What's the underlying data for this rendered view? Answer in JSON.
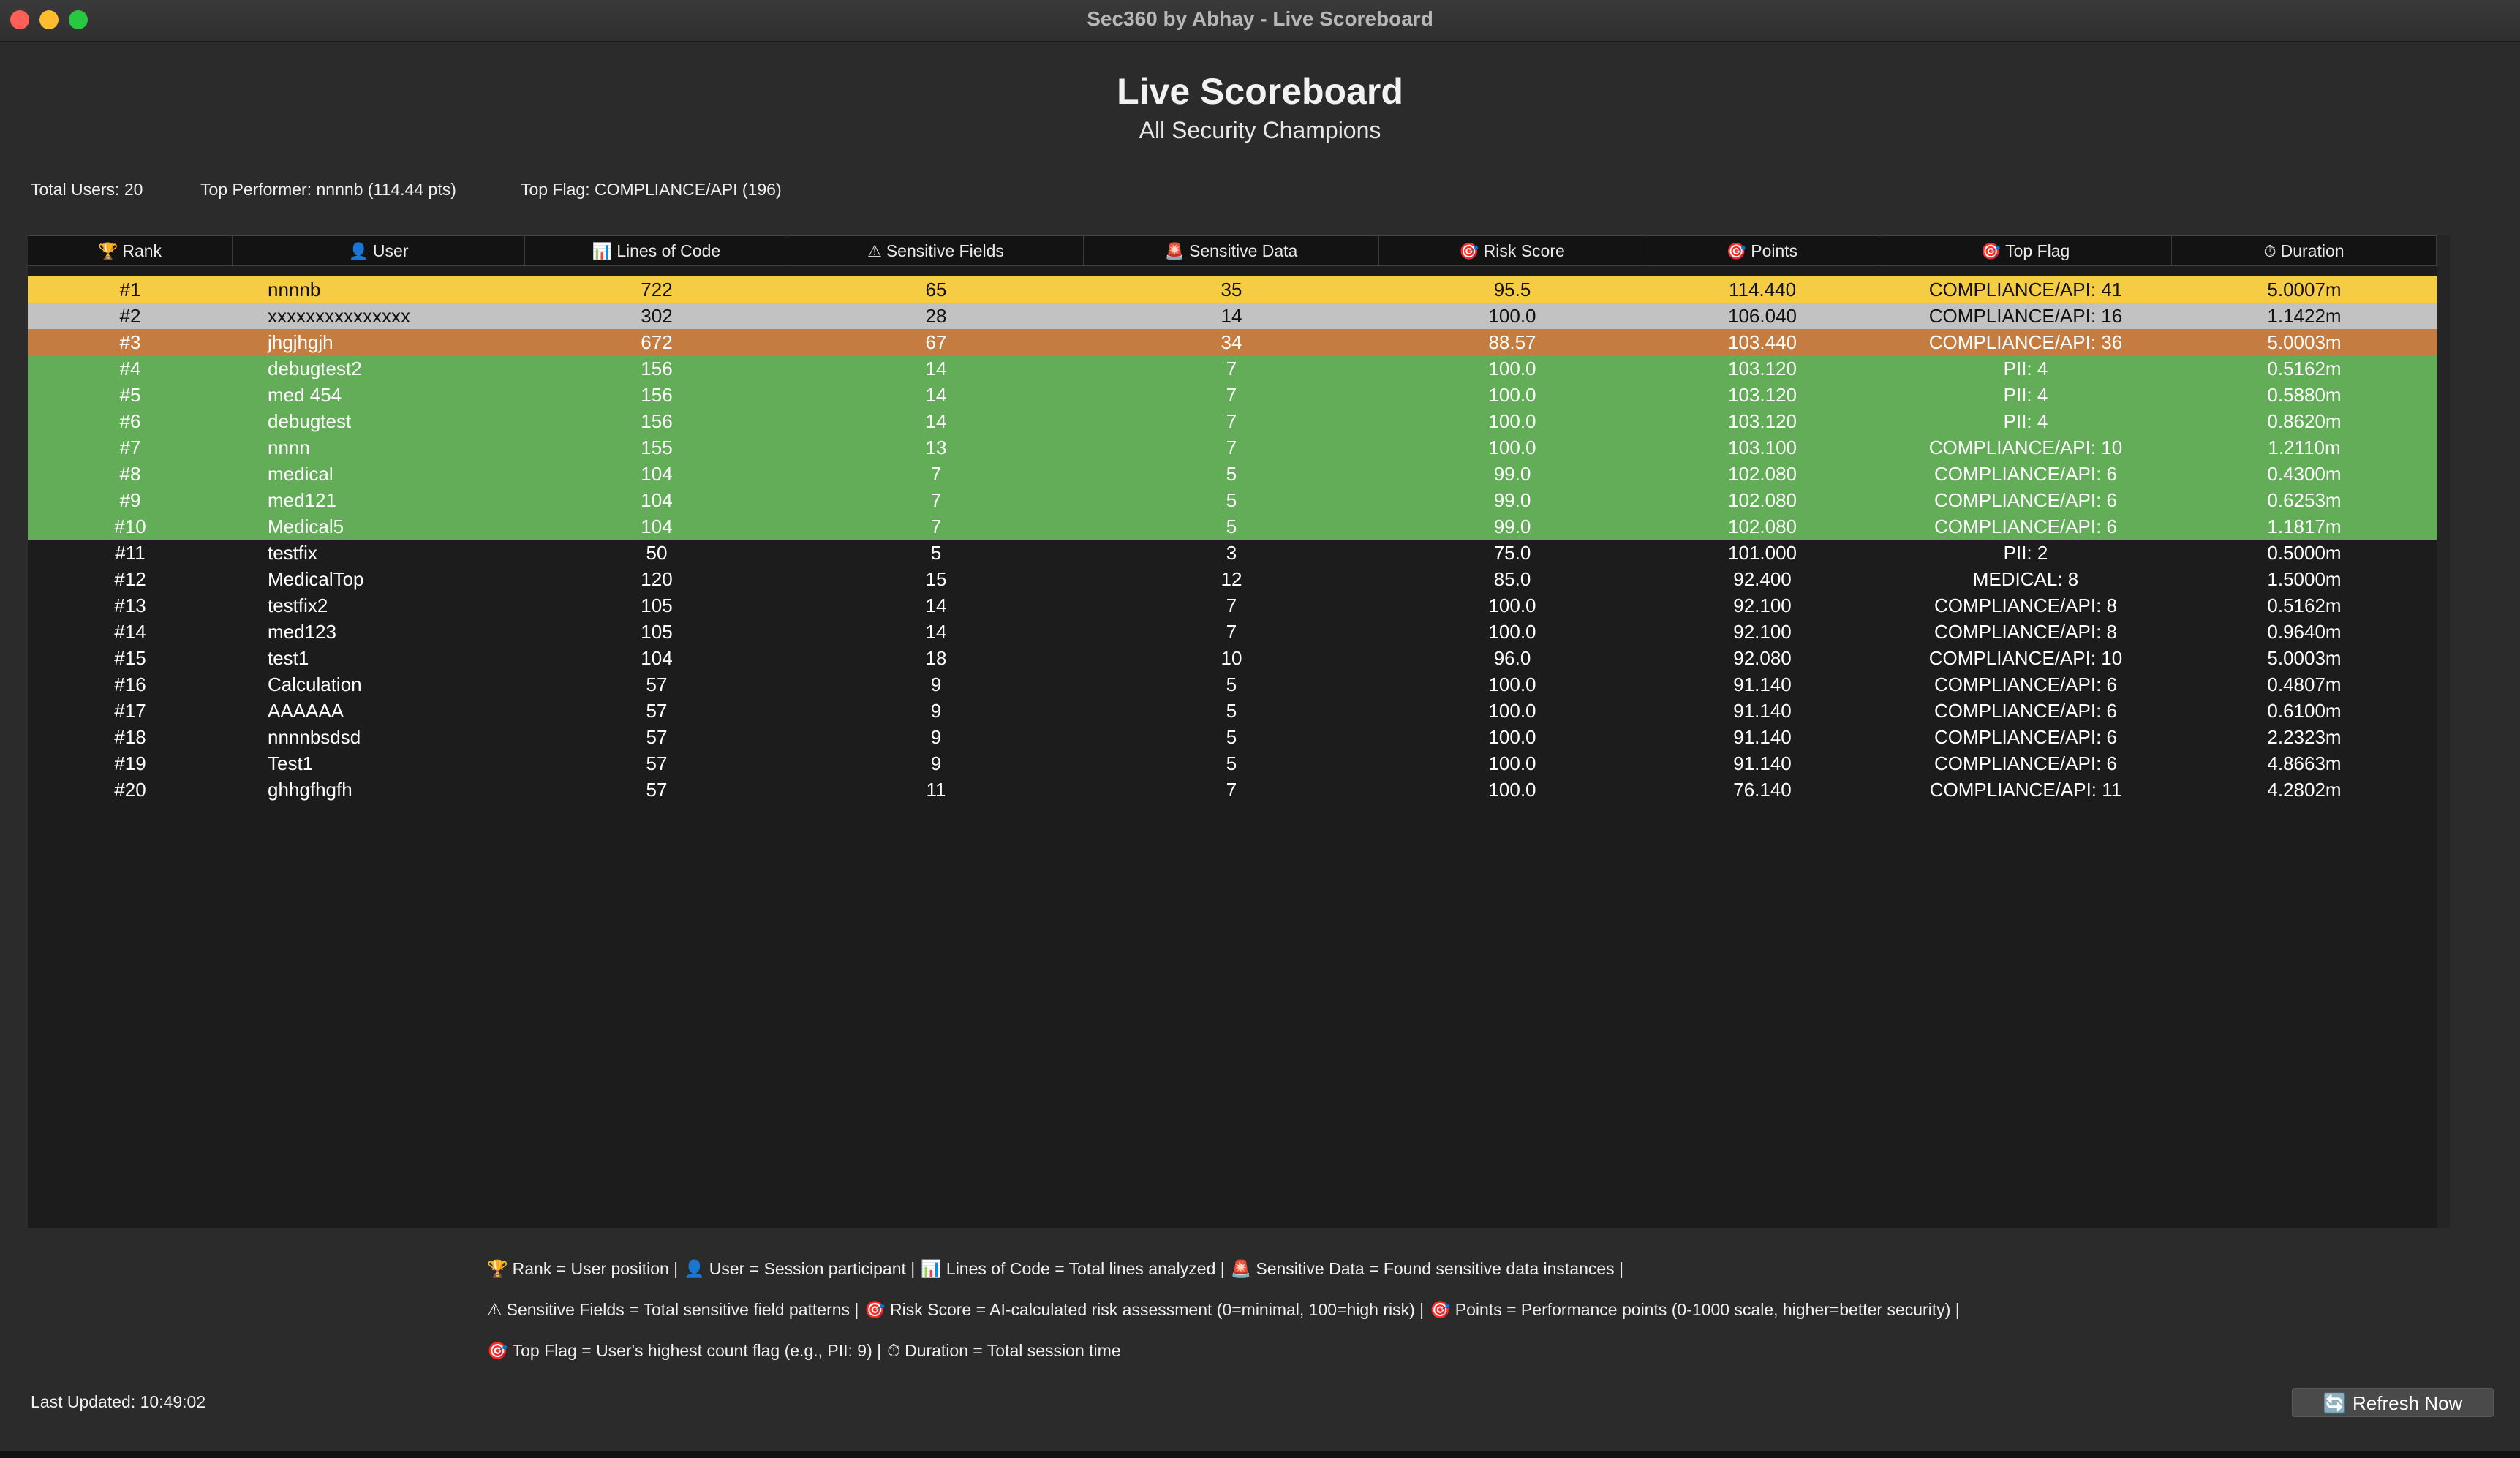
{
  "window": {
    "title": "Sec360 by Abhay - Live Scoreboard"
  },
  "header": {
    "title": "Live Scoreboard",
    "subtitle": "All Security Champions"
  },
  "stats": {
    "total_users": "Total Users: 20",
    "top_performer": "Top Performer: nnnnb (114.44 pts)",
    "top_flag": "Top Flag: COMPLIANCE/API (196)"
  },
  "table": {
    "columns": [
      {
        "icon": "trophy-icon",
        "glyph": "🏆",
        "label": "Rank"
      },
      {
        "icon": "user-icon",
        "glyph": "👤",
        "label": "User"
      },
      {
        "icon": "bar-chart-icon",
        "glyph": "📊",
        "label": "Lines of Code"
      },
      {
        "icon": "warning-icon",
        "glyph": "⚠",
        "label": "Sensitive Fields"
      },
      {
        "icon": "alarm-light-icon",
        "glyph": "🚨",
        "label": "Sensitive Data"
      },
      {
        "icon": "target-icon",
        "glyph": "🎯",
        "label": "Risk Score"
      },
      {
        "icon": "target-icon",
        "glyph": "🎯",
        "label": "Points"
      },
      {
        "icon": "target-icon",
        "glyph": "🎯",
        "label": "Top Flag"
      },
      {
        "icon": "timer-icon",
        "glyph": "⏱",
        "label": "Duration"
      }
    ],
    "rows": [
      {
        "rank": "#1",
        "user": "nnnnb",
        "loc": "722",
        "fields": "65",
        "data": "35",
        "risk": "95.5",
        "points": "114.440",
        "flag": "COMPLIANCE/API: 41",
        "duration": "5.0007m",
        "tier": "gold"
      },
      {
        "rank": "#2",
        "user": "xxxxxxxxxxxxxxx",
        "loc": "302",
        "fields": "28",
        "data": "14",
        "risk": "100.0",
        "points": "106.040",
        "flag": "COMPLIANCE/API: 16",
        "duration": "1.1422m",
        "tier": "silver"
      },
      {
        "rank": "#3",
        "user": "jhgjhgjh",
        "loc": "672",
        "fields": "67",
        "data": "34",
        "risk": "88.57",
        "points": "103.440",
        "flag": "COMPLIANCE/API: 36",
        "duration": "5.0003m",
        "tier": "bronze"
      },
      {
        "rank": "#4",
        "user": "debugtest2",
        "loc": "156",
        "fields": "14",
        "data": "7",
        "risk": "100.0",
        "points": "103.120",
        "flag": "PII: 4",
        "duration": "0.5162m",
        "tier": "top10"
      },
      {
        "rank": "#5",
        "user": "med 454",
        "loc": "156",
        "fields": "14",
        "data": "7",
        "risk": "100.0",
        "points": "103.120",
        "flag": "PII: 4",
        "duration": "0.5880m",
        "tier": "top10"
      },
      {
        "rank": "#6",
        "user": "debugtest",
        "loc": "156",
        "fields": "14",
        "data": "7",
        "risk": "100.0",
        "points": "103.120",
        "flag": "PII: 4",
        "duration": "0.8620m",
        "tier": "top10"
      },
      {
        "rank": "#7",
        "user": "nnnn",
        "loc": "155",
        "fields": "13",
        "data": "7",
        "risk": "100.0",
        "points": "103.100",
        "flag": "COMPLIANCE/API: 10",
        "duration": "1.2110m",
        "tier": "top10"
      },
      {
        "rank": "#8",
        "user": "medical",
        "loc": "104",
        "fields": "7",
        "data": "5",
        "risk": "99.0",
        "points": "102.080",
        "flag": "COMPLIANCE/API: 6",
        "duration": "0.4300m",
        "tier": "top10"
      },
      {
        "rank": "#9",
        "user": "med121",
        "loc": "104",
        "fields": "7",
        "data": "5",
        "risk": "99.0",
        "points": "102.080",
        "flag": "COMPLIANCE/API: 6",
        "duration": "0.6253m",
        "tier": "top10"
      },
      {
        "rank": "#10",
        "user": "Medical5",
        "loc": "104",
        "fields": "7",
        "data": "5",
        "risk": "99.0",
        "points": "102.080",
        "flag": "COMPLIANCE/API: 6",
        "duration": "1.1817m",
        "tier": "top10"
      },
      {
        "rank": "#11",
        "user": "testfix",
        "loc": "50",
        "fields": "5",
        "data": "3",
        "risk": "75.0",
        "points": "101.000",
        "flag": "PII: 2",
        "duration": "0.5000m",
        "tier": "normal"
      },
      {
        "rank": "#12",
        "user": "MedicalTop",
        "loc": "120",
        "fields": "15",
        "data": "12",
        "risk": "85.0",
        "points": "92.400",
        "flag": "MEDICAL: 8",
        "duration": "1.5000m",
        "tier": "normal"
      },
      {
        "rank": "#13",
        "user": "testfix2",
        "loc": "105",
        "fields": "14",
        "data": "7",
        "risk": "100.0",
        "points": "92.100",
        "flag": "COMPLIANCE/API: 8",
        "duration": "0.5162m",
        "tier": "normal"
      },
      {
        "rank": "#14",
        "user": "med123",
        "loc": "105",
        "fields": "14",
        "data": "7",
        "risk": "100.0",
        "points": "92.100",
        "flag": "COMPLIANCE/API: 8",
        "duration": "0.9640m",
        "tier": "normal"
      },
      {
        "rank": "#15",
        "user": "test1",
        "loc": "104",
        "fields": "18",
        "data": "10",
        "risk": "96.0",
        "points": "92.080",
        "flag": "COMPLIANCE/API: 10",
        "duration": "5.0003m",
        "tier": "normal"
      },
      {
        "rank": "#16",
        "user": "Calculation",
        "loc": "57",
        "fields": "9",
        "data": "5",
        "risk": "100.0",
        "points": "91.140",
        "flag": "COMPLIANCE/API: 6",
        "duration": "0.4807m",
        "tier": "normal"
      },
      {
        "rank": "#17",
        "user": "AAAAAA",
        "loc": "57",
        "fields": "9",
        "data": "5",
        "risk": "100.0",
        "points": "91.140",
        "flag": "COMPLIANCE/API: 6",
        "duration": "0.6100m",
        "tier": "normal"
      },
      {
        "rank": "#18",
        "user": "nnnnbsdsd",
        "loc": "57",
        "fields": "9",
        "data": "5",
        "risk": "100.0",
        "points": "91.140",
        "flag": "COMPLIANCE/API: 6",
        "duration": "2.2323m",
        "tier": "normal"
      },
      {
        "rank": "#19",
        "user": "Test1",
        "loc": "57",
        "fields": "9",
        "data": "5",
        "risk": "100.0",
        "points": "91.140",
        "flag": "COMPLIANCE/API: 6",
        "duration": "4.8663m",
        "tier": "normal"
      },
      {
        "rank": "#20",
        "user": "ghhgfhgfh",
        "loc": "57",
        "fields": "11",
        "data": "7",
        "risk": "100.0",
        "points": "76.140",
        "flag": "COMPLIANCE/API: 11",
        "duration": "4.2802m",
        "tier": "normal"
      }
    ]
  },
  "legend": {
    "line1": [
      {
        "glyph": "🏆",
        "text": "Rank = User position |"
      },
      {
        "glyph": "👤",
        "text": "User = Session participant |"
      },
      {
        "glyph": "📊",
        "text": "Lines of Code = Total lines analyzed |"
      },
      {
        "glyph": "🚨",
        "text": "Sensitive Data = Found sensitive data instances |"
      }
    ],
    "line2": [
      {
        "glyph": "⚠",
        "text": "Sensitive Fields = Total sensitive field patterns |"
      },
      {
        "glyph": "🎯",
        "text": "Risk Score = AI-calculated risk assessment (0=minimal, 100=high risk) |"
      },
      {
        "glyph": "🎯",
        "text": "Points = Performance points (0-1000 scale, higher=better security) |"
      }
    ],
    "line3": [
      {
        "glyph": "🎯",
        "text": "Top Flag = User's highest count flag (e.g., PII: 9) |"
      },
      {
        "glyph": "⏱",
        "text": "Duration = Total session time"
      }
    ]
  },
  "footer": {
    "last_updated": "Last Updated: 10:49:02",
    "refresh_label": "Refresh Now",
    "refresh_glyph": "🔄"
  },
  "colors": {
    "gold": "#f7cc45",
    "silver": "#c2c2c2",
    "bronze": "#c57c40",
    "top10": "#63ac58",
    "normal": "#1c1c1c"
  }
}
